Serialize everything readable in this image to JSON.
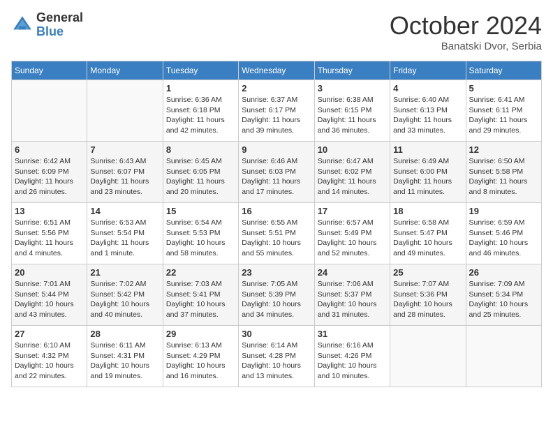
{
  "header": {
    "logo_general": "General",
    "logo_blue": "Blue",
    "month_title": "October 2024",
    "location": "Banatski Dvor, Serbia"
  },
  "days_of_week": [
    "Sunday",
    "Monday",
    "Tuesday",
    "Wednesday",
    "Thursday",
    "Friday",
    "Saturday"
  ],
  "weeks": [
    [
      {
        "day": "",
        "info": ""
      },
      {
        "day": "",
        "info": ""
      },
      {
        "day": "1",
        "info": "Sunrise: 6:36 AM\nSunset: 6:18 PM\nDaylight: 11 hours and 42 minutes."
      },
      {
        "day": "2",
        "info": "Sunrise: 6:37 AM\nSunset: 6:17 PM\nDaylight: 11 hours and 39 minutes."
      },
      {
        "day": "3",
        "info": "Sunrise: 6:38 AM\nSunset: 6:15 PM\nDaylight: 11 hours and 36 minutes."
      },
      {
        "day": "4",
        "info": "Sunrise: 6:40 AM\nSunset: 6:13 PM\nDaylight: 11 hours and 33 minutes."
      },
      {
        "day": "5",
        "info": "Sunrise: 6:41 AM\nSunset: 6:11 PM\nDaylight: 11 hours and 29 minutes."
      }
    ],
    [
      {
        "day": "6",
        "info": "Sunrise: 6:42 AM\nSunset: 6:09 PM\nDaylight: 11 hours and 26 minutes."
      },
      {
        "day": "7",
        "info": "Sunrise: 6:43 AM\nSunset: 6:07 PM\nDaylight: 11 hours and 23 minutes."
      },
      {
        "day": "8",
        "info": "Sunrise: 6:45 AM\nSunset: 6:05 PM\nDaylight: 11 hours and 20 minutes."
      },
      {
        "day": "9",
        "info": "Sunrise: 6:46 AM\nSunset: 6:03 PM\nDaylight: 11 hours and 17 minutes."
      },
      {
        "day": "10",
        "info": "Sunrise: 6:47 AM\nSunset: 6:02 PM\nDaylight: 11 hours and 14 minutes."
      },
      {
        "day": "11",
        "info": "Sunrise: 6:49 AM\nSunset: 6:00 PM\nDaylight: 11 hours and 11 minutes."
      },
      {
        "day": "12",
        "info": "Sunrise: 6:50 AM\nSunset: 5:58 PM\nDaylight: 11 hours and 8 minutes."
      }
    ],
    [
      {
        "day": "13",
        "info": "Sunrise: 6:51 AM\nSunset: 5:56 PM\nDaylight: 11 hours and 4 minutes."
      },
      {
        "day": "14",
        "info": "Sunrise: 6:53 AM\nSunset: 5:54 PM\nDaylight: 11 hours and 1 minute."
      },
      {
        "day": "15",
        "info": "Sunrise: 6:54 AM\nSunset: 5:53 PM\nDaylight: 10 hours and 58 minutes."
      },
      {
        "day": "16",
        "info": "Sunrise: 6:55 AM\nSunset: 5:51 PM\nDaylight: 10 hours and 55 minutes."
      },
      {
        "day": "17",
        "info": "Sunrise: 6:57 AM\nSunset: 5:49 PM\nDaylight: 10 hours and 52 minutes."
      },
      {
        "day": "18",
        "info": "Sunrise: 6:58 AM\nSunset: 5:47 PM\nDaylight: 10 hours and 49 minutes."
      },
      {
        "day": "19",
        "info": "Sunrise: 6:59 AM\nSunset: 5:46 PM\nDaylight: 10 hours and 46 minutes."
      }
    ],
    [
      {
        "day": "20",
        "info": "Sunrise: 7:01 AM\nSunset: 5:44 PM\nDaylight: 10 hours and 43 minutes."
      },
      {
        "day": "21",
        "info": "Sunrise: 7:02 AM\nSunset: 5:42 PM\nDaylight: 10 hours and 40 minutes."
      },
      {
        "day": "22",
        "info": "Sunrise: 7:03 AM\nSunset: 5:41 PM\nDaylight: 10 hours and 37 minutes."
      },
      {
        "day": "23",
        "info": "Sunrise: 7:05 AM\nSunset: 5:39 PM\nDaylight: 10 hours and 34 minutes."
      },
      {
        "day": "24",
        "info": "Sunrise: 7:06 AM\nSunset: 5:37 PM\nDaylight: 10 hours and 31 minutes."
      },
      {
        "day": "25",
        "info": "Sunrise: 7:07 AM\nSunset: 5:36 PM\nDaylight: 10 hours and 28 minutes."
      },
      {
        "day": "26",
        "info": "Sunrise: 7:09 AM\nSunset: 5:34 PM\nDaylight: 10 hours and 25 minutes."
      }
    ],
    [
      {
        "day": "27",
        "info": "Sunrise: 6:10 AM\nSunset: 4:32 PM\nDaylight: 10 hours and 22 minutes."
      },
      {
        "day": "28",
        "info": "Sunrise: 6:11 AM\nSunset: 4:31 PM\nDaylight: 10 hours and 19 minutes."
      },
      {
        "day": "29",
        "info": "Sunrise: 6:13 AM\nSunset: 4:29 PM\nDaylight: 10 hours and 16 minutes."
      },
      {
        "day": "30",
        "info": "Sunrise: 6:14 AM\nSunset: 4:28 PM\nDaylight: 10 hours and 13 minutes."
      },
      {
        "day": "31",
        "info": "Sunrise: 6:16 AM\nSunset: 4:26 PM\nDaylight: 10 hours and 10 minutes."
      },
      {
        "day": "",
        "info": ""
      },
      {
        "day": "",
        "info": ""
      }
    ]
  ]
}
